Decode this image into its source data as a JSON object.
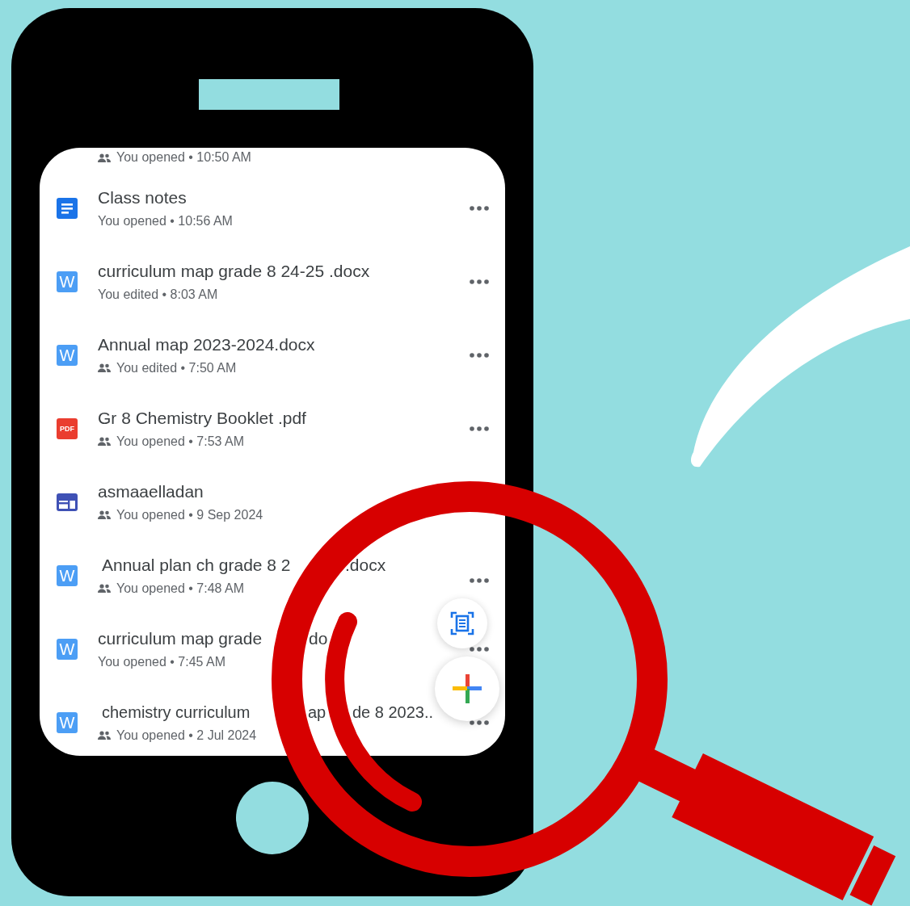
{
  "top_partial_row": {
    "shared": true,
    "meta": "You opened • 10:50 AM"
  },
  "files": [
    {
      "kind": "docs",
      "title_parts": [
        "Class notes"
      ],
      "shared": false,
      "meta": "You opened • 10:56 AM",
      "menu": true
    },
    {
      "kind": "word",
      "icon_text": "W",
      "title_parts": [
        "curriculum map grade 8 24-25 .docx"
      ],
      "shared": false,
      "meta": "You edited • 8:03 AM",
      "menu": true
    },
    {
      "kind": "word",
      "icon_text": "W",
      "title_parts": [
        "Annual map 2023-2024.docx"
      ],
      "shared": true,
      "meta": "You edited • 7:50 AM",
      "menu": true
    },
    {
      "kind": "pdf",
      "icon_text": "PDF",
      "title_parts": [
        "Gr 8 Chemistry Booklet .pdf"
      ],
      "shared": true,
      "meta": "You opened • 7:53 AM",
      "menu": true
    },
    {
      "kind": "sites",
      "title_parts": [
        "asmaaelladan"
      ],
      "shared": true,
      "meta": "You opened • 9 Sep 2024",
      "menu": false
    },
    {
      "kind": "word",
      "icon_text": "W",
      "title_parts": [
        "Annual plan ch grade 8 2",
        ".docx"
      ],
      "shared": true,
      "meta": "You opened • 7:48 AM",
      "menu": true
    },
    {
      "kind": "word",
      "icon_text": "W",
      "title_parts": [
        "curriculum map grade",
        "do"
      ],
      "shared": false,
      "meta": "You opened • 7:45 AM",
      "menu": true
    },
    {
      "kind": "word",
      "icon_text": "W",
      "title_parts": [
        "chemistry curriculum",
        "ap",
        "de 8 2023.."
      ],
      "shared": true,
      "meta": "You opened • 2 Jul 2024",
      "menu": true
    }
  ]
}
